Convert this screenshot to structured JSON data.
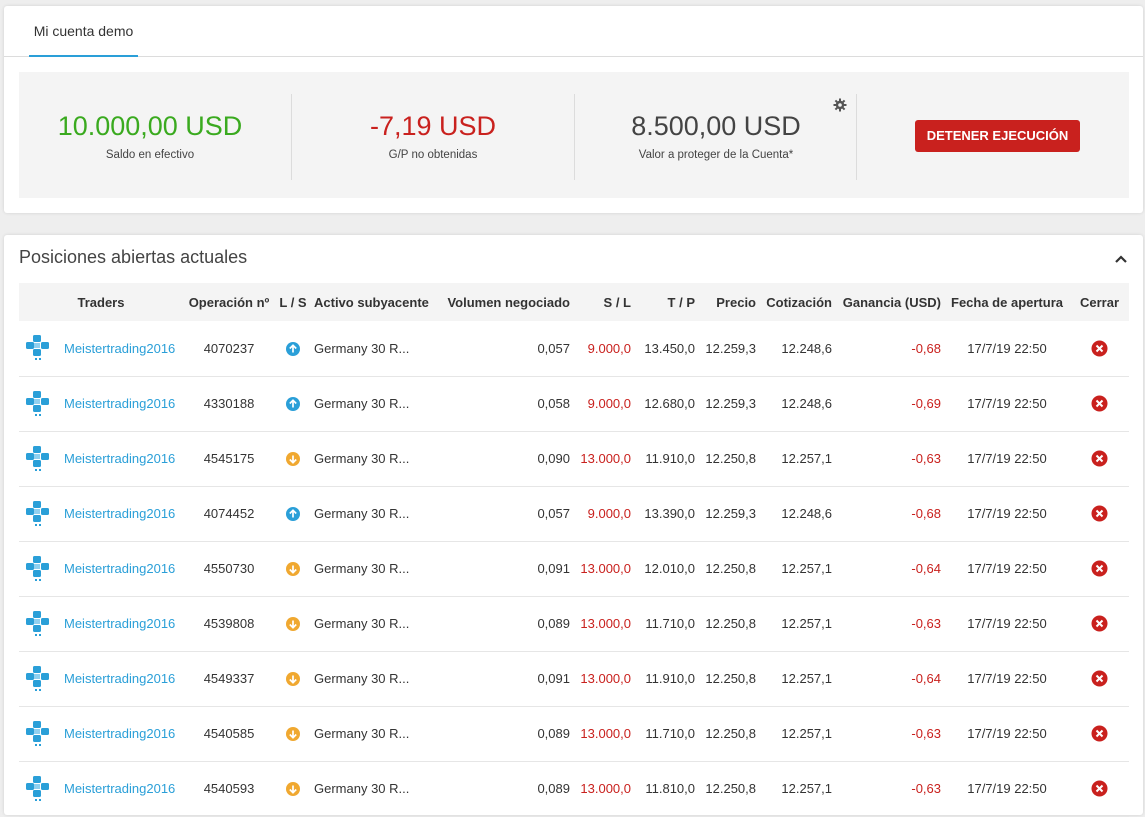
{
  "tab": {
    "label": "Mi cuenta demo"
  },
  "summary": {
    "cash": {
      "value": "10.000,00 USD",
      "label": "Saldo en efectivo",
      "color": "#3aaa1f"
    },
    "pnl": {
      "value": "-7,19 USD",
      "label": "G/P no obtenidas",
      "color": "#c9211e"
    },
    "protect": {
      "value": "8.500,00 USD",
      "label": "Valor a proteger de la Cuenta*",
      "color": "#444444"
    },
    "settings_icon": "gear-icon",
    "stop_button": "DETENER EJECUCIÓN"
  },
  "positions": {
    "title": "Posiciones abiertas actuales",
    "collapse_icon": "chevron-up-icon",
    "columns": [
      "Traders",
      "Operación nº",
      "L / S",
      "Activo subyacente",
      "Volumen negociado",
      "S / L",
      "T / P",
      "Precio",
      "Cotización",
      "Ganancia (USD)",
      "Fecha de apertura",
      "Cerrar"
    ],
    "rows": [
      {
        "trader": "Meistertrading2016",
        "op": "4070237",
        "dir": "long",
        "asset": "Germany 30 R...",
        "vol": "0,057",
        "sl": "9.000,0",
        "tp": "13.450,0",
        "price": "12.259,3",
        "quote": "12.248,6",
        "gain": "-0,68",
        "date": "17/7/19 22:50"
      },
      {
        "trader": "Meistertrading2016",
        "op": "4330188",
        "dir": "long",
        "asset": "Germany 30 R...",
        "vol": "0,058",
        "sl": "9.000,0",
        "tp": "12.680,0",
        "price": "12.259,3",
        "quote": "12.248,6",
        "gain": "-0,69",
        "date": "17/7/19 22:50"
      },
      {
        "trader": "Meistertrading2016",
        "op": "4545175",
        "dir": "short",
        "asset": "Germany 30 R...",
        "vol": "0,090",
        "sl": "13.000,0",
        "tp": "11.910,0",
        "price": "12.250,8",
        "quote": "12.257,1",
        "gain": "-0,63",
        "date": "17/7/19 22:50"
      },
      {
        "trader": "Meistertrading2016",
        "op": "4074452",
        "dir": "long",
        "asset": "Germany 30 R...",
        "vol": "0,057",
        "sl": "9.000,0",
        "tp": "13.390,0",
        "price": "12.259,3",
        "quote": "12.248,6",
        "gain": "-0,68",
        "date": "17/7/19 22:50"
      },
      {
        "trader": "Meistertrading2016",
        "op": "4550730",
        "dir": "short",
        "asset": "Germany 30 R...",
        "vol": "0,091",
        "sl": "13.000,0",
        "tp": "12.010,0",
        "price": "12.250,8",
        "quote": "12.257,1",
        "gain": "-0,64",
        "date": "17/7/19 22:50"
      },
      {
        "trader": "Meistertrading2016",
        "op": "4539808",
        "dir": "short",
        "asset": "Germany 30 R...",
        "vol": "0,089",
        "sl": "13.000,0",
        "tp": "11.710,0",
        "price": "12.250,8",
        "quote": "12.257,1",
        "gain": "-0,63",
        "date": "17/7/19 22:50"
      },
      {
        "trader": "Meistertrading2016",
        "op": "4549337",
        "dir": "short",
        "asset": "Germany 30 R...",
        "vol": "0,091",
        "sl": "13.000,0",
        "tp": "11.910,0",
        "price": "12.250,8",
        "quote": "12.257,1",
        "gain": "-0,64",
        "date": "17/7/19 22:50"
      },
      {
        "trader": "Meistertrading2016",
        "op": "4540585",
        "dir": "short",
        "asset": "Germany 30 R...",
        "vol": "0,089",
        "sl": "13.000,0",
        "tp": "11.710,0",
        "price": "12.250,8",
        "quote": "12.257,1",
        "gain": "-0,63",
        "date": "17/7/19 22:50"
      },
      {
        "trader": "Meistertrading2016",
        "op": "4540593",
        "dir": "short",
        "asset": "Germany 30 R...",
        "vol": "0,089",
        "sl": "13.000,0",
        "tp": "11.810,0",
        "price": "12.250,8",
        "quote": "12.257,1",
        "gain": "-0,63",
        "date": "17/7/19 22:50"
      }
    ]
  },
  "colors": {
    "accent": "#2a9fd8",
    "negative": "#c9211e",
    "positive": "#3aaa1f",
    "long_icon": "#2a9fd8",
    "short_icon": "#f0a830"
  }
}
